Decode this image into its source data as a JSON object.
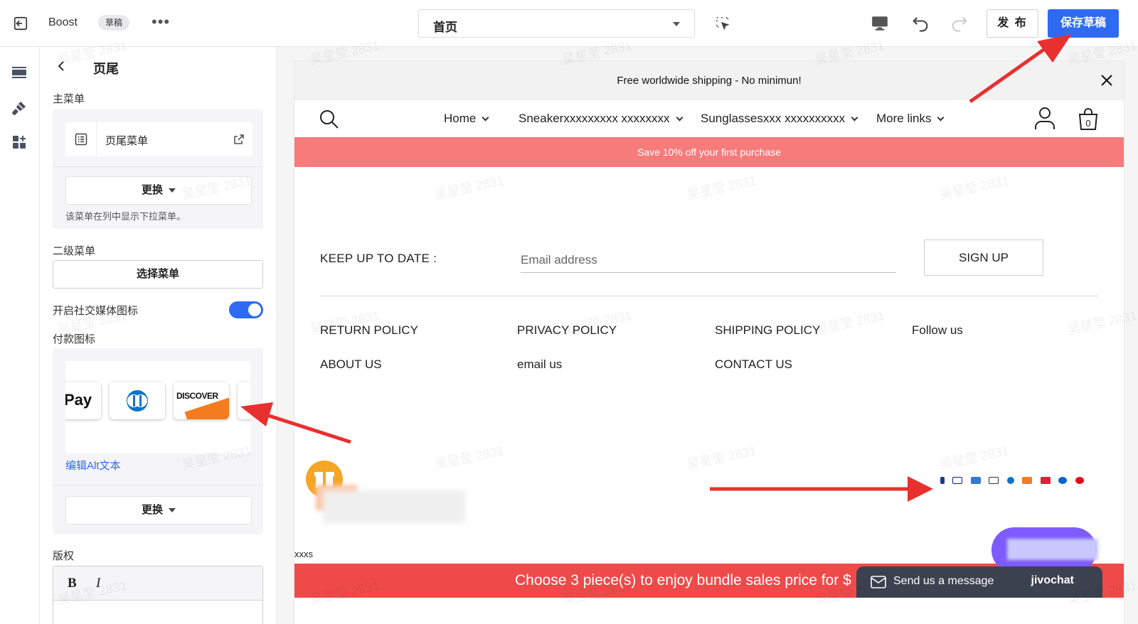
{
  "topbar": {
    "app_name": "Boost",
    "draft_badge": "草稿",
    "more": "•••",
    "page_select": "首页",
    "publish": "发 布",
    "save_draft": "保存草稿"
  },
  "panel": {
    "title": "页尾",
    "main_menu_label": "主菜单",
    "main_menu_item": "页尾菜单",
    "change_button": "更换",
    "main_menu_hint": "该菜单在列中显示下拉菜单。",
    "submenu_label": "二级菜单",
    "choose_menu_button": "选择菜单",
    "social_toggle_label": "开启社交媒体图标",
    "social_toggle_on": true,
    "payment_icons_label": "付款图标",
    "payment_cards": [
      "Pay",
      "Diners",
      "DISCOVER"
    ],
    "edit_alt_text": "编辑Alt文本",
    "change_button_2": "更换",
    "copyright_label": "版权",
    "rte_bold": "B",
    "rte_italic": "I"
  },
  "preview": {
    "announcement": "Free worldwide shipping - No minimun!",
    "nav": [
      "Home",
      "Sneakerxxxxxxxxx xxxxxxxx",
      "Sunglassesxxx xxxxxxxxxx",
      "More links"
    ],
    "cart_count": "0",
    "promo": "Save 10% off your first purchase",
    "newsletter_label": "KEEP UP TO DATE :",
    "email_placeholder": "Email address",
    "signup": "SIGN UP",
    "footer_links": {
      "col1": [
        "RETURN POLICY",
        "ABOUT US"
      ],
      "col2": [
        "PRIVACY POLICY",
        "email us"
      ],
      "col3": [
        "SHIPPING POLICY",
        "CONTACT US"
      ],
      "col4": [
        "Follow us"
      ]
    },
    "copyright": "xxxs",
    "bundle_bar": "Choose 3 piece(s) to enjoy bundle sales price for $",
    "chat_message": "Send us a message",
    "chat_brand": "jivochat"
  },
  "colors": {
    "accent": "#2f6bf2",
    "promo_bar": "#f77b7b",
    "bundle_bar": "#ef4a4a",
    "annotation_arrow": "#e8302f"
  },
  "watermark": "吴星莹 2831"
}
